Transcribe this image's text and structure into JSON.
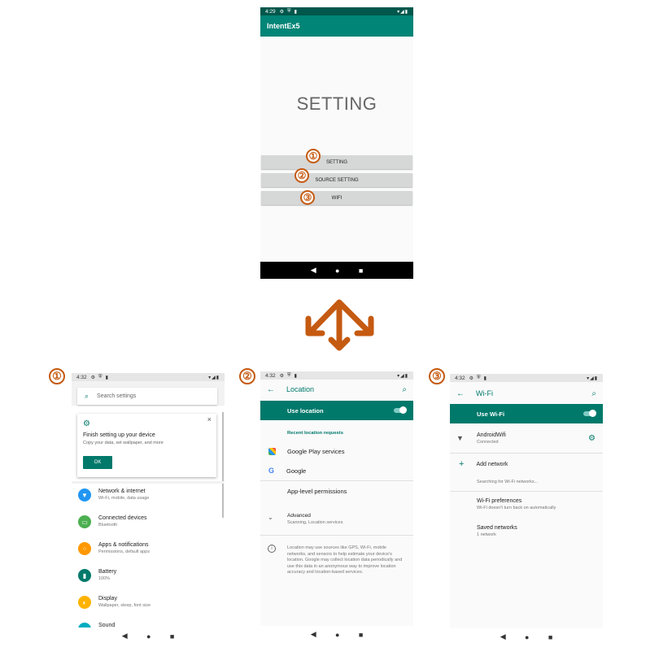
{
  "markers": {
    "m1": "①",
    "m2": "②",
    "m3": "③"
  },
  "top_phone": {
    "status_time": "4:29",
    "app_title": "IntentEx5",
    "heading": "SETTING",
    "buttons": [
      "SETTING",
      "SOURCE SETTING",
      "WIFI"
    ]
  },
  "settings_phone": {
    "status_time": "4:32",
    "search_placeholder": "Search settings",
    "card": {
      "title": "Finish setting up your device",
      "subtitle": "Copy your data, set wallpaper, and more",
      "ok_label": "OK"
    },
    "items": [
      {
        "title": "Network & internet",
        "sub": "Wi-Fi, mobile, data usage",
        "color": "#2196f3",
        "icon": "wifi-icon"
      },
      {
        "title": "Connected devices",
        "sub": "Bluetooth",
        "color": "#4caf50",
        "icon": "devices-icon"
      },
      {
        "title": "Apps & notifications",
        "sub": "Permissions, default apps",
        "color": "#ff9800",
        "icon": "apps-icon"
      },
      {
        "title": "Battery",
        "sub": "100%",
        "color": "#00796b",
        "icon": "battery-icon"
      },
      {
        "title": "Display",
        "sub": "Wallpaper, sleep, font size",
        "color": "#ffb300",
        "icon": "display-icon"
      },
      {
        "title": "Sound",
        "sub": "",
        "color": "#00acc1",
        "icon": "sound-icon"
      }
    ]
  },
  "location_phone": {
    "status_time": "4:32",
    "title": "Location",
    "toggle_label": "Use location",
    "section_header": "Recent location requests",
    "apps": [
      {
        "label": "Google Play services",
        "icon": "play-services-icon"
      },
      {
        "label": "Google",
        "icon": "google-icon"
      }
    ],
    "app_permissions": "App-level permissions",
    "advanced_title": "Advanced",
    "advanced_sub": "Scanning, Location services",
    "info_text": "Location may use sources like GPS, Wi-Fi, mobile networks, and sensors to help estimate your device's location. Google may collect location data periodically and use this data in an anonymous way to improve location accuracy and location-based services."
  },
  "wifi_phone": {
    "status_time": "4:32",
    "title": "Wi-Fi",
    "toggle_label": "Use Wi-Fi",
    "network_name": "AndroidWifi",
    "network_status": "Connected",
    "add_network": "Add network",
    "searching": "Searching for Wi-Fi networks...",
    "prefs_title": "Wi-Fi preferences",
    "prefs_sub": "Wi-Fi doesn't turn back on automatically",
    "saved_title": "Saved networks",
    "saved_sub": "1 network"
  },
  "colors": {
    "teal": "#00796b",
    "accent_orange": "#c55a11",
    "button_gray": "#d6d7d7"
  }
}
